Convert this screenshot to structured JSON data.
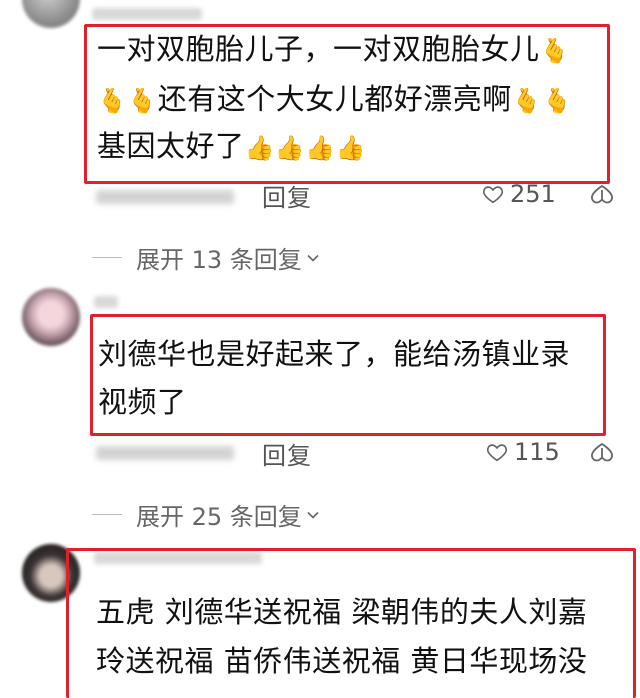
{
  "comments": [
    {
      "lines": [
        "一对双胞胎儿子，一对双胞胎女儿",
        "还有这个大女儿都好漂亮啊",
        "基因太好了"
      ],
      "reply_label": "回复",
      "likes": "251",
      "expand_label": "展开 13 条回复"
    },
    {
      "lines": [
        "刘德华也是好起来了，能给汤镇业录",
        "视频了"
      ],
      "reply_label": "回复",
      "likes": "115",
      "expand_label": "展开 25 条回复"
    },
    {
      "lines": [
        "五虎 刘德华送祝福 梁朝伟的夫人刘嘉",
        "玲送祝福 苗侨伟送祝福 黄日华现场没"
      ]
    }
  ],
  "emoji": {
    "finger_heart": "🫰",
    "thumbs_up": "👍"
  },
  "colors": {
    "highlight_border": "#e0202a",
    "meta_text": "#555555"
  },
  "icons": [
    "heart-outline-icon",
    "dislike-icon",
    "chevron-down-icon"
  ]
}
